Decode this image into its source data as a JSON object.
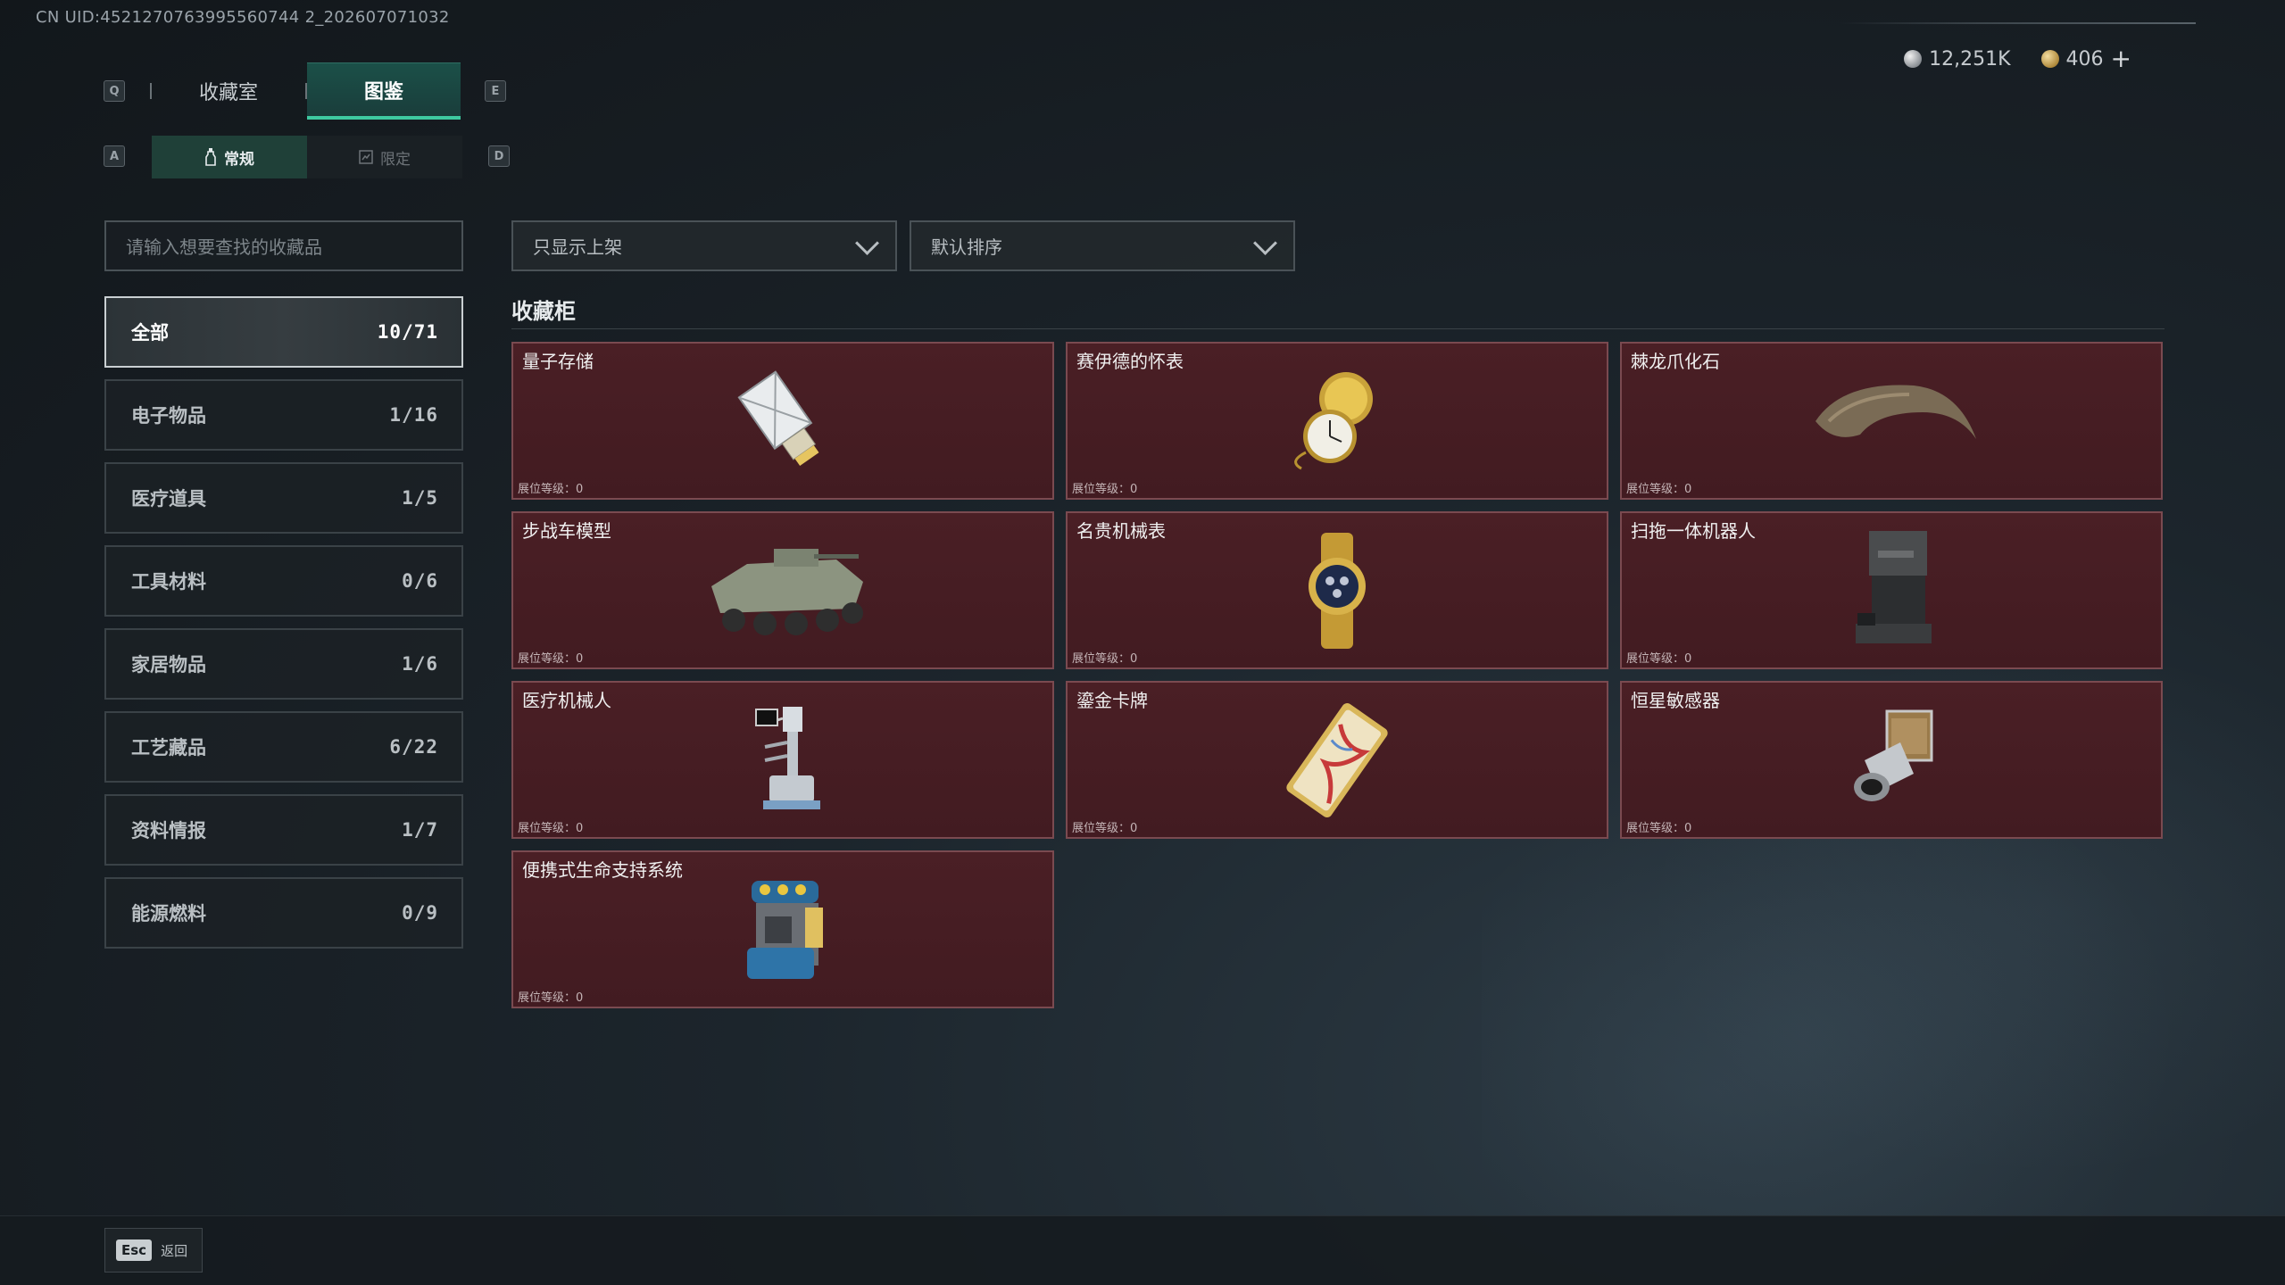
{
  "uid": "CN UID:4521270763995560744 2_202607071032",
  "keys": {
    "q": "Q",
    "e": "E",
    "a": "A",
    "d": "D"
  },
  "top_tabs": [
    {
      "label": "收藏室",
      "active": false
    },
    {
      "label": "图鉴",
      "active": true
    }
  ],
  "sub_tabs": [
    {
      "label": "常规",
      "active": true
    },
    {
      "label": "限定",
      "active": false
    }
  ],
  "currency": {
    "silver": "12,251K",
    "gold": "406",
    "add": "+"
  },
  "search": {
    "placeholder": "请输入想要查找的收藏品"
  },
  "filters": {
    "shelf": "只显示上架",
    "sort": "默认排序"
  },
  "categories": [
    {
      "label": "全部",
      "count": "10/71",
      "active": true
    },
    {
      "label": "电子物品",
      "count": "1/16"
    },
    {
      "label": "医疗道具",
      "count": "1/5"
    },
    {
      "label": "工具材料",
      "count": "0/6"
    },
    {
      "label": "家居物品",
      "count": "1/6"
    },
    {
      "label": "工艺藏品",
      "count": "6/22"
    },
    {
      "label": "资料情报",
      "count": "1/7"
    },
    {
      "label": "能源燃料",
      "count": "0/9"
    }
  ],
  "section_title": "收藏柜",
  "items": [
    {
      "name": "量子存储",
      "level": "展位等级：0",
      "icon": "usb-drive-icon"
    },
    {
      "name": "赛伊德的怀表",
      "level": "展位等级：0",
      "icon": "pocket-watch-icon"
    },
    {
      "name": "棘龙爪化石",
      "level": "展位等级：0",
      "icon": "claw-fossil-icon"
    },
    {
      "name": "步战车模型",
      "level": "展位等级：0",
      "icon": "ifv-model-icon"
    },
    {
      "name": "名贵机械表",
      "level": "展位等级：0",
      "icon": "wristwatch-icon"
    },
    {
      "name": "扫拖一体机器人",
      "level": "展位等级：0",
      "icon": "mop-robot-icon"
    },
    {
      "name": "医疗机械人",
      "level": "展位等级：0",
      "icon": "medical-robot-icon"
    },
    {
      "name": "鎏金卡牌",
      "level": "展位等级：0",
      "icon": "gilded-card-icon"
    },
    {
      "name": "恒星敏感器",
      "level": "展位等级：0",
      "icon": "star-sensor-icon"
    },
    {
      "name": "便携式生命支持系统",
      "level": "展位等级：0",
      "icon": "life-support-icon"
    }
  ],
  "footer": {
    "esc_key": "Esc",
    "esc_label": "返回"
  }
}
